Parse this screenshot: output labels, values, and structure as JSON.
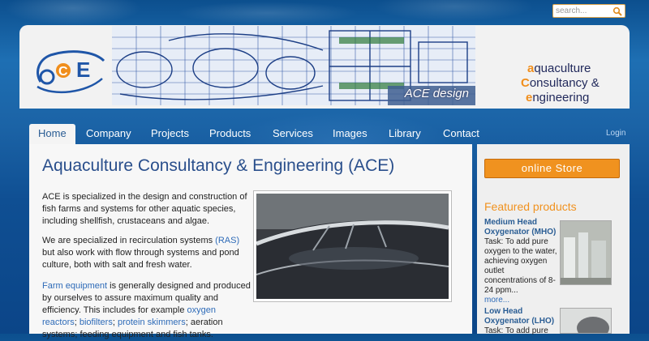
{
  "search": {
    "placeholder": "search..."
  },
  "brand": {
    "line1_initial": "a",
    "line1_rest": "quaculture",
    "line2_initial": "C",
    "line2_rest": "onsultancy &",
    "line3_initial": "e",
    "line3_rest": "ngineering"
  },
  "banner": {
    "caption": "ACE design"
  },
  "nav": {
    "items": [
      "Home",
      "Company",
      "Projects",
      "Products",
      "Services",
      "Images",
      "Library",
      "Contact"
    ],
    "login": "Login"
  },
  "main": {
    "title": "Aquaculture Consultancy & Engineering (ACE)",
    "p1": "ACE is specialized in the design and construction of fish farms and systems for other aquatic species, including shellfish, crustaceans and algae.",
    "p2_a": "We are specialized in recirculation systems ",
    "p2_link": "(RAS)",
    "p2_b": " but also work with flow through systems and pond culture, both with salt and fresh water.",
    "p3_link1": "Farm equipment",
    "p3_a": " is generally designed and produced by ourselves to assure maximum quality and efficiency. This includes for example ",
    "p3_link2": "oxygen reactors",
    "p3_sep1": "; ",
    "p3_link3": "biofilters",
    "p3_sep2": ";",
    "p3_link4": "protein skimmers",
    "p3_b": "; aeration systems; feeding equipment and fish tanks."
  },
  "sidebar": {
    "store_label": "online Store",
    "featured_title": "Featured products",
    "products": [
      {
        "title": "Medium Head Oxygenator (MHO)",
        "desc": "Task: To add pure oxygen to the water, achieving oxygen outlet concentrations of 8-24 ppm...",
        "more": "more..."
      },
      {
        "title": "Low Head Oxygenator (LHO)",
        "desc": "Task: To add pure",
        "more": ""
      }
    ]
  },
  "colors": {
    "accent": "#f0921f",
    "link": "#2e6bb8",
    "title": "#2a4f8c",
    "nav_bg": "#1b63a6"
  }
}
